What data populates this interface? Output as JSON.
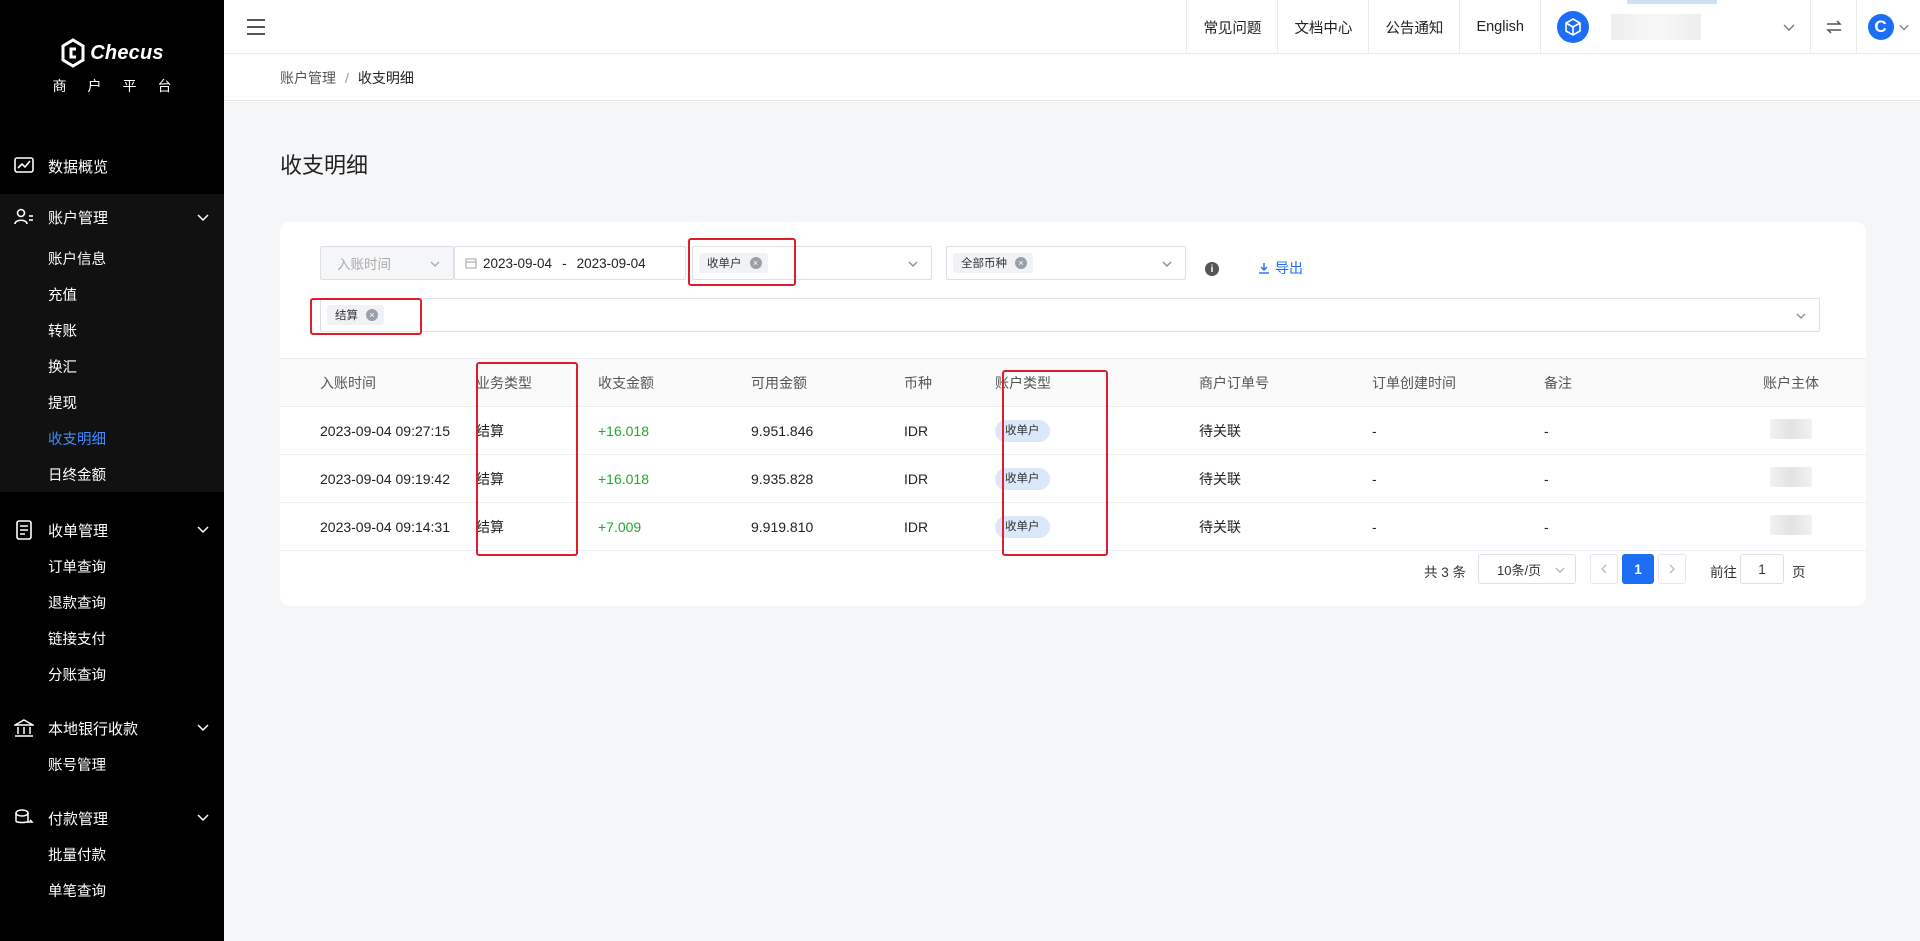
{
  "brand": {
    "name": "Checus",
    "subtitle": "商户平台"
  },
  "sidebar": {
    "overview": "数据概览",
    "account_mgmt": {
      "label": "账户管理",
      "items": [
        "账户信息",
        "充值",
        "转账",
        "换汇",
        "提现",
        "收支明细",
        "日终金额"
      ]
    },
    "collection_mgmt": {
      "label": "收单管理",
      "items": [
        "订单查询",
        "退款查询",
        "链接支付",
        "分账查询"
      ]
    },
    "local_bank": {
      "label": "本地银行收款",
      "items": [
        "账号管理"
      ]
    },
    "payout_mgmt": {
      "label": "付款管理",
      "items": [
        "批量付款",
        "单笔查询"
      ]
    },
    "active_item": "收支明细"
  },
  "topbar": {
    "faq": "常见问题",
    "docs": "文档中心",
    "notice": "公告通知",
    "language": "English",
    "avatar_letter": "C"
  },
  "breadcrumb": {
    "parent": "账户管理",
    "current": "收支明细"
  },
  "page": {
    "title": "收支明细"
  },
  "filters": {
    "time_type_placeholder": "入账时间",
    "date_start": "2023-09-04",
    "date_sep": "-",
    "date_end": "2023-09-04",
    "account_type_tag": "收单户",
    "currency_tag": "全部币种",
    "business_type_tag": "结算",
    "export_label": "导出"
  },
  "table": {
    "headers": [
      "入账时间",
      "业务类型",
      "收支金额",
      "可用金额",
      "币种",
      "账户类型",
      "商户订单号",
      "订单创建时间",
      "备注",
      "账户主体"
    ],
    "rows": [
      [
        "2023-09-04 09:27:15",
        "结算",
        "+16.018",
        "9.951.846",
        "IDR",
        "收单户",
        "待关联",
        "-",
        "-"
      ],
      [
        "2023-09-04 09:19:42",
        "结算",
        "+16.018",
        "9.935.828",
        "IDR",
        "收单户",
        "待关联",
        "-",
        "-"
      ],
      [
        "2023-09-04 09:14:31",
        "结算",
        "+7.009",
        "9.919.810",
        "IDR",
        "收单户",
        "待关联",
        "-",
        "-"
      ]
    ]
  },
  "pagination": {
    "total": "共 3 条",
    "page_size": "10条/页",
    "current": "1",
    "goto_label": "前往",
    "goto_value": "1",
    "page_suffix": "页"
  },
  "colors": {
    "sidebar_bg": "#000000",
    "accent": "#1e6ef5",
    "positive": "#1fab2f",
    "highlight_box": "#e11d2b"
  }
}
